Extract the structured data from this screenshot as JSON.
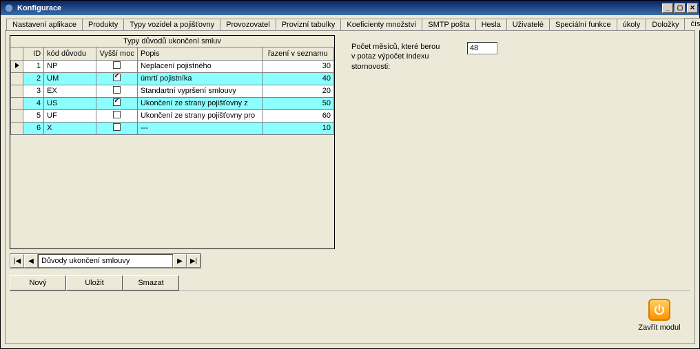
{
  "window": {
    "title": "Konfigurace"
  },
  "tabs": [
    "Nastavení aplikace",
    "Produkty",
    "Typy vozidel a pojišťovny",
    "Provozovatel",
    "Provizní tabulky",
    "Koeficienty množství",
    "SMTP pošta",
    "Hesla",
    "Uživatelé",
    "Speciální funkce",
    "úkoly",
    "Doložky",
    "číselníky ..."
  ],
  "active_tab_index": 12,
  "grid": {
    "title": "Typy důvodů ukončení smluv",
    "columns": [
      "ID",
      "kód důvodu",
      "Vyšší moc",
      "Popis",
      "řazení v seznamu"
    ],
    "rows": [
      {
        "id": 1,
        "kod": "NP",
        "vm": false,
        "popis": "Neplacení pojistného",
        "raz": 30,
        "selected": true
      },
      {
        "id": 2,
        "kod": "UM",
        "vm": true,
        "popis": "úmrtí pojistníka",
        "raz": 40
      },
      {
        "id": 3,
        "kod": "EX",
        "vm": false,
        "popis": "Standartní vypršení smlouvy",
        "raz": 20
      },
      {
        "id": 4,
        "kod": "US",
        "vm": true,
        "popis": "Ukončení ze strany pojišťovny z",
        "raz": 50
      },
      {
        "id": 5,
        "kod": "UF",
        "vm": false,
        "popis": "Ukončení ze strany pojišťovny pro",
        "raz": 60
      },
      {
        "id": 6,
        "kod": "X",
        "vm": false,
        "popis": "---",
        "raz": 10
      }
    ]
  },
  "nav": {
    "label": "Důvody ukončení smlouvy"
  },
  "buttons": {
    "new": "Nový",
    "save": "Uložit",
    "delete": "Smazat"
  },
  "months_field": {
    "label_l1": "Počet měsíců, které berou",
    "label_l2": "v potaz výpočet Indexu",
    "label_l3": "stornovosti:",
    "value": "48"
  },
  "footer": {
    "close": "Zavřít modul"
  }
}
